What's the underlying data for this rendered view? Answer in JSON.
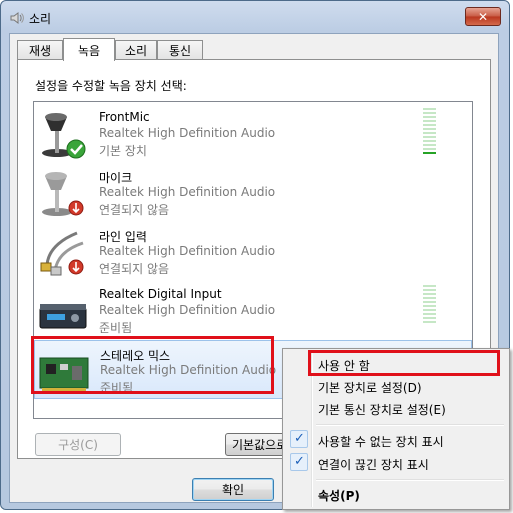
{
  "window": {
    "title": "소리",
    "close_glyph": "✕",
    "icon": "speaker-icon"
  },
  "tabs": [
    {
      "label": "재생",
      "active": false
    },
    {
      "label": "녹음",
      "active": true
    },
    {
      "label": "소리",
      "active": false
    },
    {
      "label": "통신",
      "active": false
    }
  ],
  "recording": {
    "prompt": "설정을 수정할 녹음 장치 선택:",
    "devices": [
      {
        "name": "FrontMic",
        "driver": "Realtek High Definition Audio",
        "status": "기본 장치",
        "icon": "microphone-default-icon",
        "level_ratio": 0.0
      },
      {
        "name": "마이크",
        "driver": "Realtek High Definition Audio",
        "status": "연결되지 않음",
        "icon": "microphone-unplugged-icon"
      },
      {
        "name": "라인 입력",
        "driver": "Realtek High Definition Audio",
        "status": "연결되지 않음",
        "icon": "line-in-cable-icon"
      },
      {
        "name": "Realtek Digital Input",
        "driver": "Realtek High Definition Audio",
        "status": "준비됨",
        "icon": "digital-input-device-icon"
      },
      {
        "name": "스테레오 믹스",
        "driver": "Realtek High Definition Audio",
        "status": "준비됨",
        "icon": "sound-card-icon",
        "selected": true
      }
    ]
  },
  "buttons": {
    "configure": "구성(C)",
    "set_default": "기본값으로",
    "ok": "확인"
  },
  "context_menu": {
    "items": [
      {
        "label": "사용 안 함",
        "checked": false
      },
      {
        "label": "기본 장치로 설정(D)",
        "checked": false
      },
      {
        "label": "기본 통신 장치로 설정(E)",
        "checked": false
      },
      {
        "label": "사용할 수 없는 장치 표시",
        "checked": true
      },
      {
        "label": "연결이 끊긴 장치 표시",
        "checked": true
      },
      {
        "label": "속성(P)",
        "checked": false,
        "bold": true
      }
    ],
    "check_glyph": "✓"
  },
  "colors": {
    "highlight": "#e0101a",
    "meter_on": "#26a326",
    "meter_off": "#c6e7c6"
  }
}
